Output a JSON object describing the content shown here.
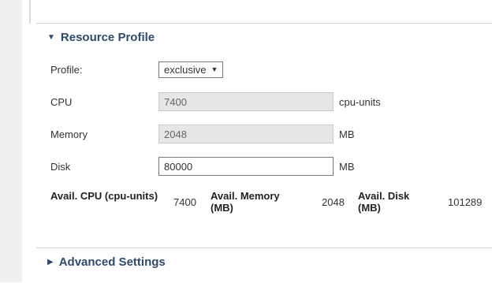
{
  "resource_profile": {
    "title": "Resource Profile",
    "fields": {
      "profile": {
        "label": "Profile:",
        "value": "exclusive"
      },
      "cpu": {
        "label": "CPU",
        "value": "7400",
        "unit": "cpu-units"
      },
      "memory": {
        "label": "Memory",
        "value": "2048",
        "unit": "MB"
      },
      "disk": {
        "label": "Disk",
        "value": "80000",
        "unit": "MB"
      }
    },
    "summary": {
      "cpu_label": "Avail. CPU (cpu-units)",
      "cpu_value": "7400",
      "memory_label": "Avail. Memory (MB)",
      "memory_value": "2048",
      "disk_label": "Avail. Disk (MB)",
      "disk_value": "101289"
    }
  },
  "advanced_settings": {
    "title": "Advanced Settings"
  },
  "icons": {
    "expanded": "caret-down-icon",
    "collapsed": "caret-right-icon",
    "dropdown": "dropdown-arrow-icon"
  }
}
